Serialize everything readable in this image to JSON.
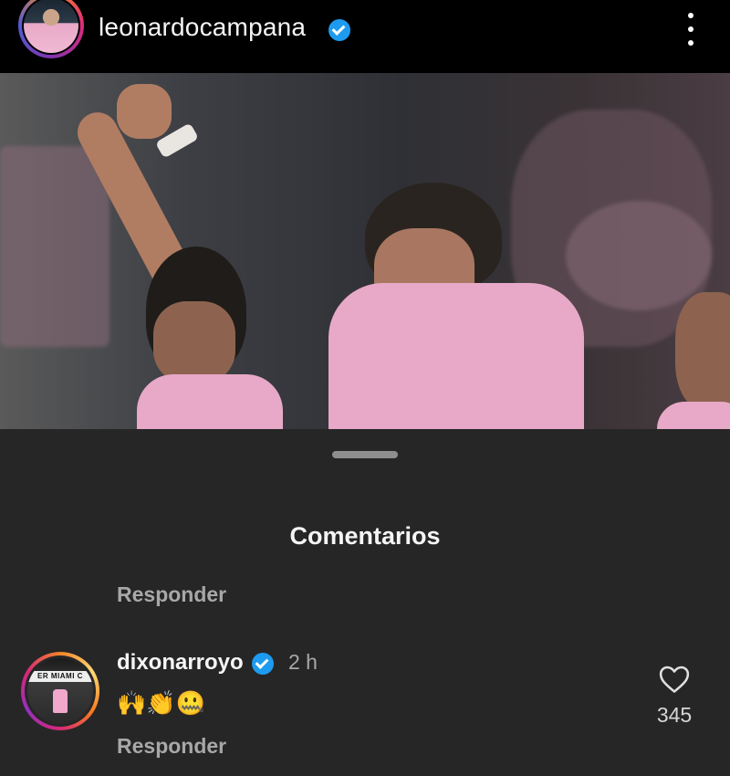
{
  "header": {
    "username": "leonardocampana",
    "verified": true,
    "menu_icon": "kebab-menu-icon"
  },
  "photo": {
    "description_icon": "post-photo"
  },
  "comments_sheet": {
    "title": "Comentarios",
    "reply_top_label": "Responder",
    "comment": {
      "username": "dixonarroyo",
      "verified": true,
      "time": "2 h",
      "text": "🙌👏🤐",
      "like_count": "345",
      "reply_label": "Responder",
      "avatar_banner": "ER MIAMI C"
    }
  },
  "colors": {
    "background": "#262626",
    "header_bg": "#000000",
    "verified_blue": "#1d9bf0",
    "secondary_text": "#a8a8a8"
  }
}
